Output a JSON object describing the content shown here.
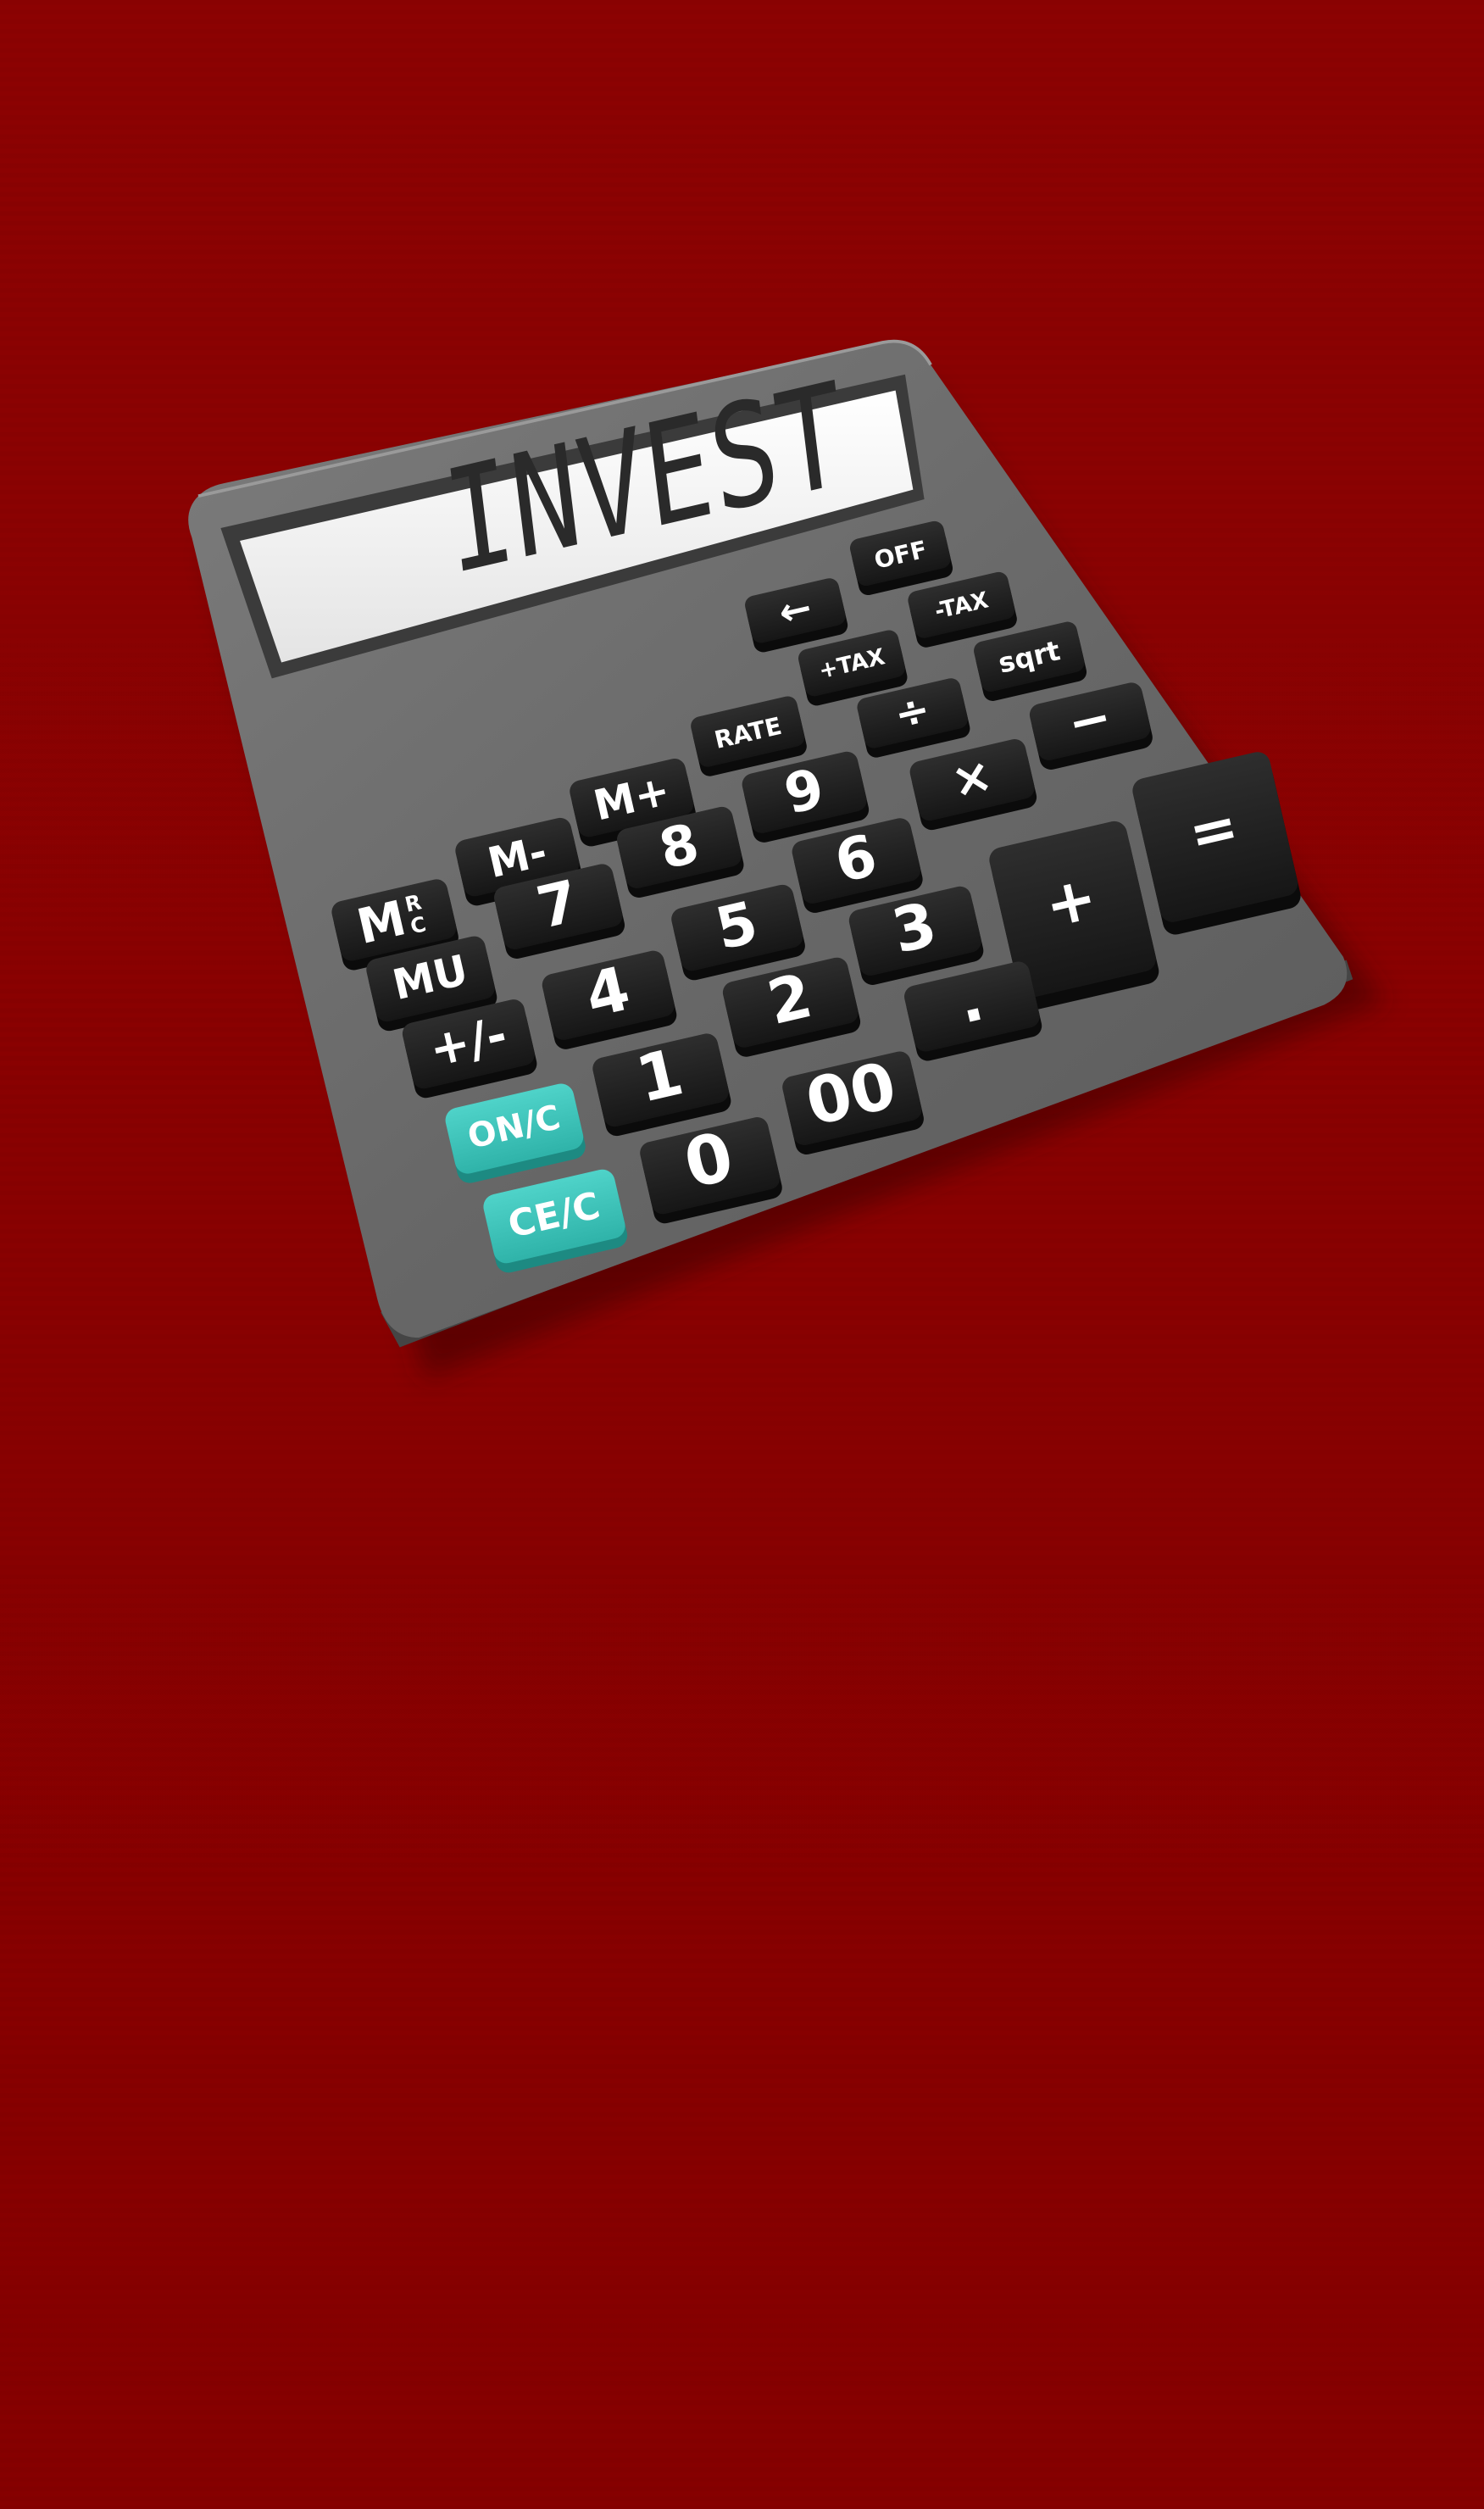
{
  "scene": {
    "background_color": "#8b0000",
    "subject": "calculator-icon"
  },
  "calculator": {
    "body_color": "#6e6e6e",
    "key_color": "#1c1c1c",
    "accent_key_color": "#3fc7bd",
    "display": {
      "text": "INVEST",
      "background_color": "#f2f2f2",
      "text_color": "#2a2a2a"
    },
    "keys": {
      "off": "OFF",
      "backspace": "←",
      "minus_tax": "-TAX",
      "plus_tax": "+TAX",
      "sqrt": "sqrt",
      "rate": "RATE",
      "divide": "÷",
      "subtract": "−",
      "m_plus": "M+",
      "m_minus": "M-",
      "mrc_main": "M",
      "mrc_sup": "R",
      "mrc_sub": "C",
      "nine": "9",
      "eight": "8",
      "seven": "7",
      "multiply": "×",
      "six": "6",
      "five": "5",
      "four": "4",
      "mu": "MU",
      "equals": "=",
      "plus": "+",
      "three": "3",
      "two": "2",
      "one": "1",
      "plus_minus": "+/-",
      "decimal": ".",
      "double_zero": "00",
      "zero": "0",
      "on_c": "ON/C",
      "ce_c": "CE/C"
    }
  }
}
